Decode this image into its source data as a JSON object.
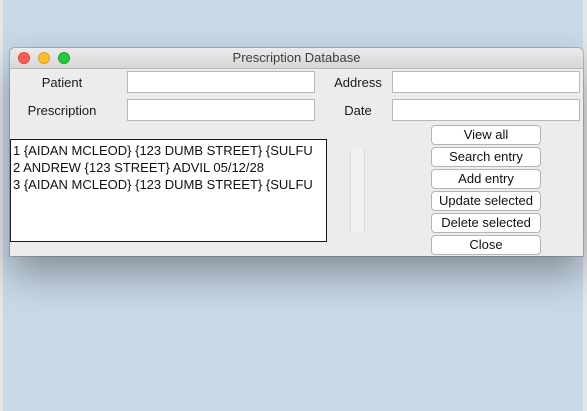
{
  "window": {
    "title": "Prescription Database"
  },
  "form": {
    "patient_label": "Patient",
    "patient_value": "",
    "address_label": "Address",
    "address_value": "",
    "prescription_label": "Prescription",
    "prescription_value": "",
    "date_label": "Date",
    "date_value": ""
  },
  "list": {
    "items": [
      "1 {AIDAN MCLEOD} {123 DUMB STREET} {SULFU",
      "2 ANDREW {123 STREET} ADVIL 05/12/28",
      "3 {AIDAN MCLEOD} {123 DUMB STREET} {SULFU"
    ]
  },
  "buttons": {
    "view_all": "View all",
    "search_entry": "Search entry",
    "add_entry": "Add entry",
    "update_selected": "Update selected",
    "delete_selected": "Delete selected",
    "close": "Close"
  },
  "colors": {
    "desktop": "#c9d9e8",
    "window": "#ececec",
    "close_light": "#fc5f57",
    "minimize_light": "#fdbc2e",
    "zoom_light": "#28c840"
  }
}
